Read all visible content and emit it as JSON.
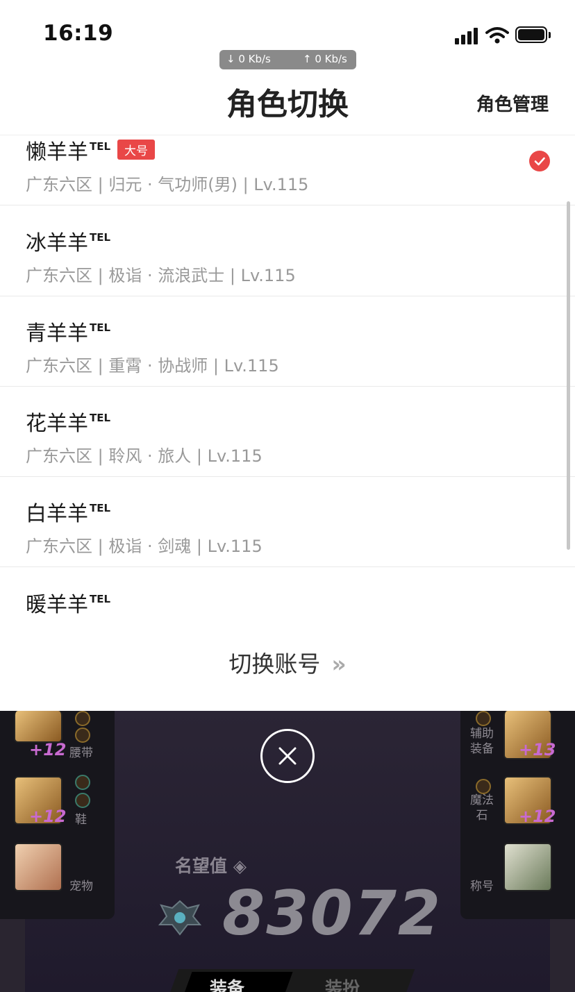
{
  "status_bar": {
    "time": "16:19",
    "net_down": "↓ 0 Kb/s",
    "net_up": "↑ 0 Kb/s"
  },
  "header": {
    "title": "角色切换",
    "manage_label": "角色管理"
  },
  "roles": [
    {
      "name": "懒羊羊",
      "tag": "TEL",
      "badge": "大号",
      "detail": "广东六区 | 归元 · 气功师(男) | Lv.115",
      "selected": true
    },
    {
      "name": "冰羊羊",
      "tag": "TEL",
      "detail": "广东六区 | 极诣 · 流浪武士 | Lv.115"
    },
    {
      "name": "青羊羊",
      "tag": "TEL",
      "detail": "广东六区 | 重霄 · 协战师 | Lv.115"
    },
    {
      "name": "花羊羊",
      "tag": "TEL",
      "detail": "广东六区 | 聆风 · 旅人 | Lv.115"
    },
    {
      "name": "白羊羊",
      "tag": "TEL",
      "detail": "广东六区 | 极诣 · 剑魂 | Lv.115"
    },
    {
      "name": "暖羊羊",
      "tag": "TEL"
    }
  ],
  "switch_account": {
    "label": "切换账号",
    "arrow": "»"
  },
  "game": {
    "left_slots": [
      {
        "label": "腰带",
        "plus": "+12"
      },
      {
        "label": "鞋",
        "plus": "+12"
      },
      {
        "label": "宠物"
      }
    ],
    "right_slots": [
      {
        "label": "辅助\n装备",
        "plus": "+13"
      },
      {
        "label": "魔法\n石",
        "plus": "+12"
      },
      {
        "label": "称号"
      }
    ],
    "fame_label": "名望值",
    "fame_value": "83072",
    "tabs": [
      "装备",
      "装扮"
    ]
  },
  "colors": {
    "accent": "#e94747"
  }
}
